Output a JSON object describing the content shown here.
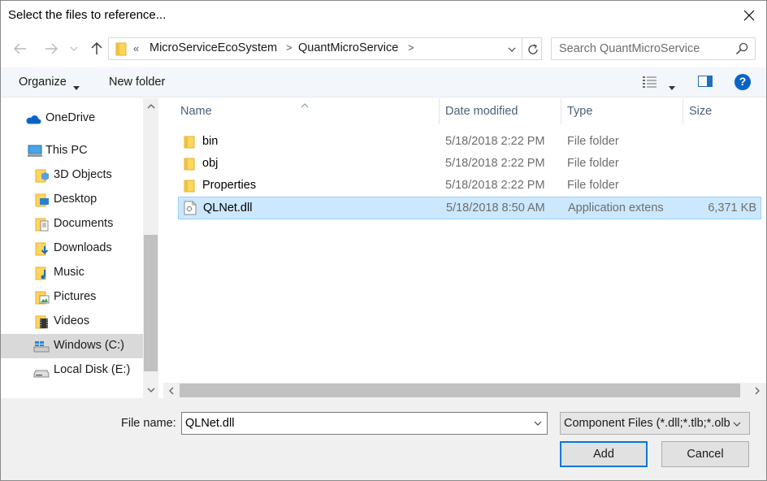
{
  "window": {
    "title": "Select the files to reference...",
    "close_icon": "close-icon"
  },
  "navbar": {
    "breadcrumb_overflow": "«",
    "breadcrumbs": [
      "MicroServiceEcoSystem",
      "QuantMicroService"
    ],
    "breadcrumb_separator": ">",
    "search_placeholder": "Search QuantMicroService"
  },
  "toolbar": {
    "organize_label": "Organize",
    "new_folder_label": "New folder",
    "help_label": "?"
  },
  "sidebar": {
    "items": [
      {
        "label": "OneDrive",
        "icon": "onedrive-cloud-icon"
      },
      {
        "label": "This PC",
        "icon": "computer-icon"
      },
      {
        "label": "3D Objects",
        "icon": "3d-objects-folder-icon"
      },
      {
        "label": "Desktop",
        "icon": "desktop-folder-icon"
      },
      {
        "label": "Documents",
        "icon": "documents-folder-icon"
      },
      {
        "label": "Downloads",
        "icon": "downloads-folder-icon"
      },
      {
        "label": "Music",
        "icon": "music-folder-icon"
      },
      {
        "label": "Pictures",
        "icon": "pictures-folder-icon"
      },
      {
        "label": "Videos",
        "icon": "videos-folder-icon"
      },
      {
        "label": "Windows (C:)",
        "icon": "windows-drive-icon",
        "selected": true
      },
      {
        "label": "Local Disk (E:)",
        "icon": "disk-drive-icon"
      }
    ]
  },
  "filelist": {
    "columns": {
      "name": "Name",
      "date": "Date modified",
      "type": "Type",
      "size": "Size"
    },
    "rows": [
      {
        "name": "bin",
        "date": "5/18/2018 2:22 PM",
        "type": "File folder",
        "size": "",
        "icon": "folder-icon"
      },
      {
        "name": "obj",
        "date": "5/18/2018 2:22 PM",
        "type": "File folder",
        "size": "",
        "icon": "folder-icon"
      },
      {
        "name": "Properties",
        "date": "5/18/2018 2:22 PM",
        "type": "File folder",
        "size": "",
        "icon": "folder-icon"
      },
      {
        "name": "QLNet.dll",
        "date": "5/18/2018 8:50 AM",
        "type": "Application extens",
        "size": "6,371 KB",
        "icon": "dll-file-icon",
        "selected": true
      }
    ]
  },
  "bottom": {
    "file_name_label": "File name:",
    "file_name_value": "QLNet.dll",
    "filter_value": "Component Files (*.dll;*.tlb;*.olb",
    "add_label": "Add",
    "cancel_label": "Cancel"
  },
  "colors": {
    "selection_bg": "#cce8ff",
    "selection_border": "#99d1ff",
    "accent": "#0078d7",
    "folder": "#ffd65c"
  }
}
